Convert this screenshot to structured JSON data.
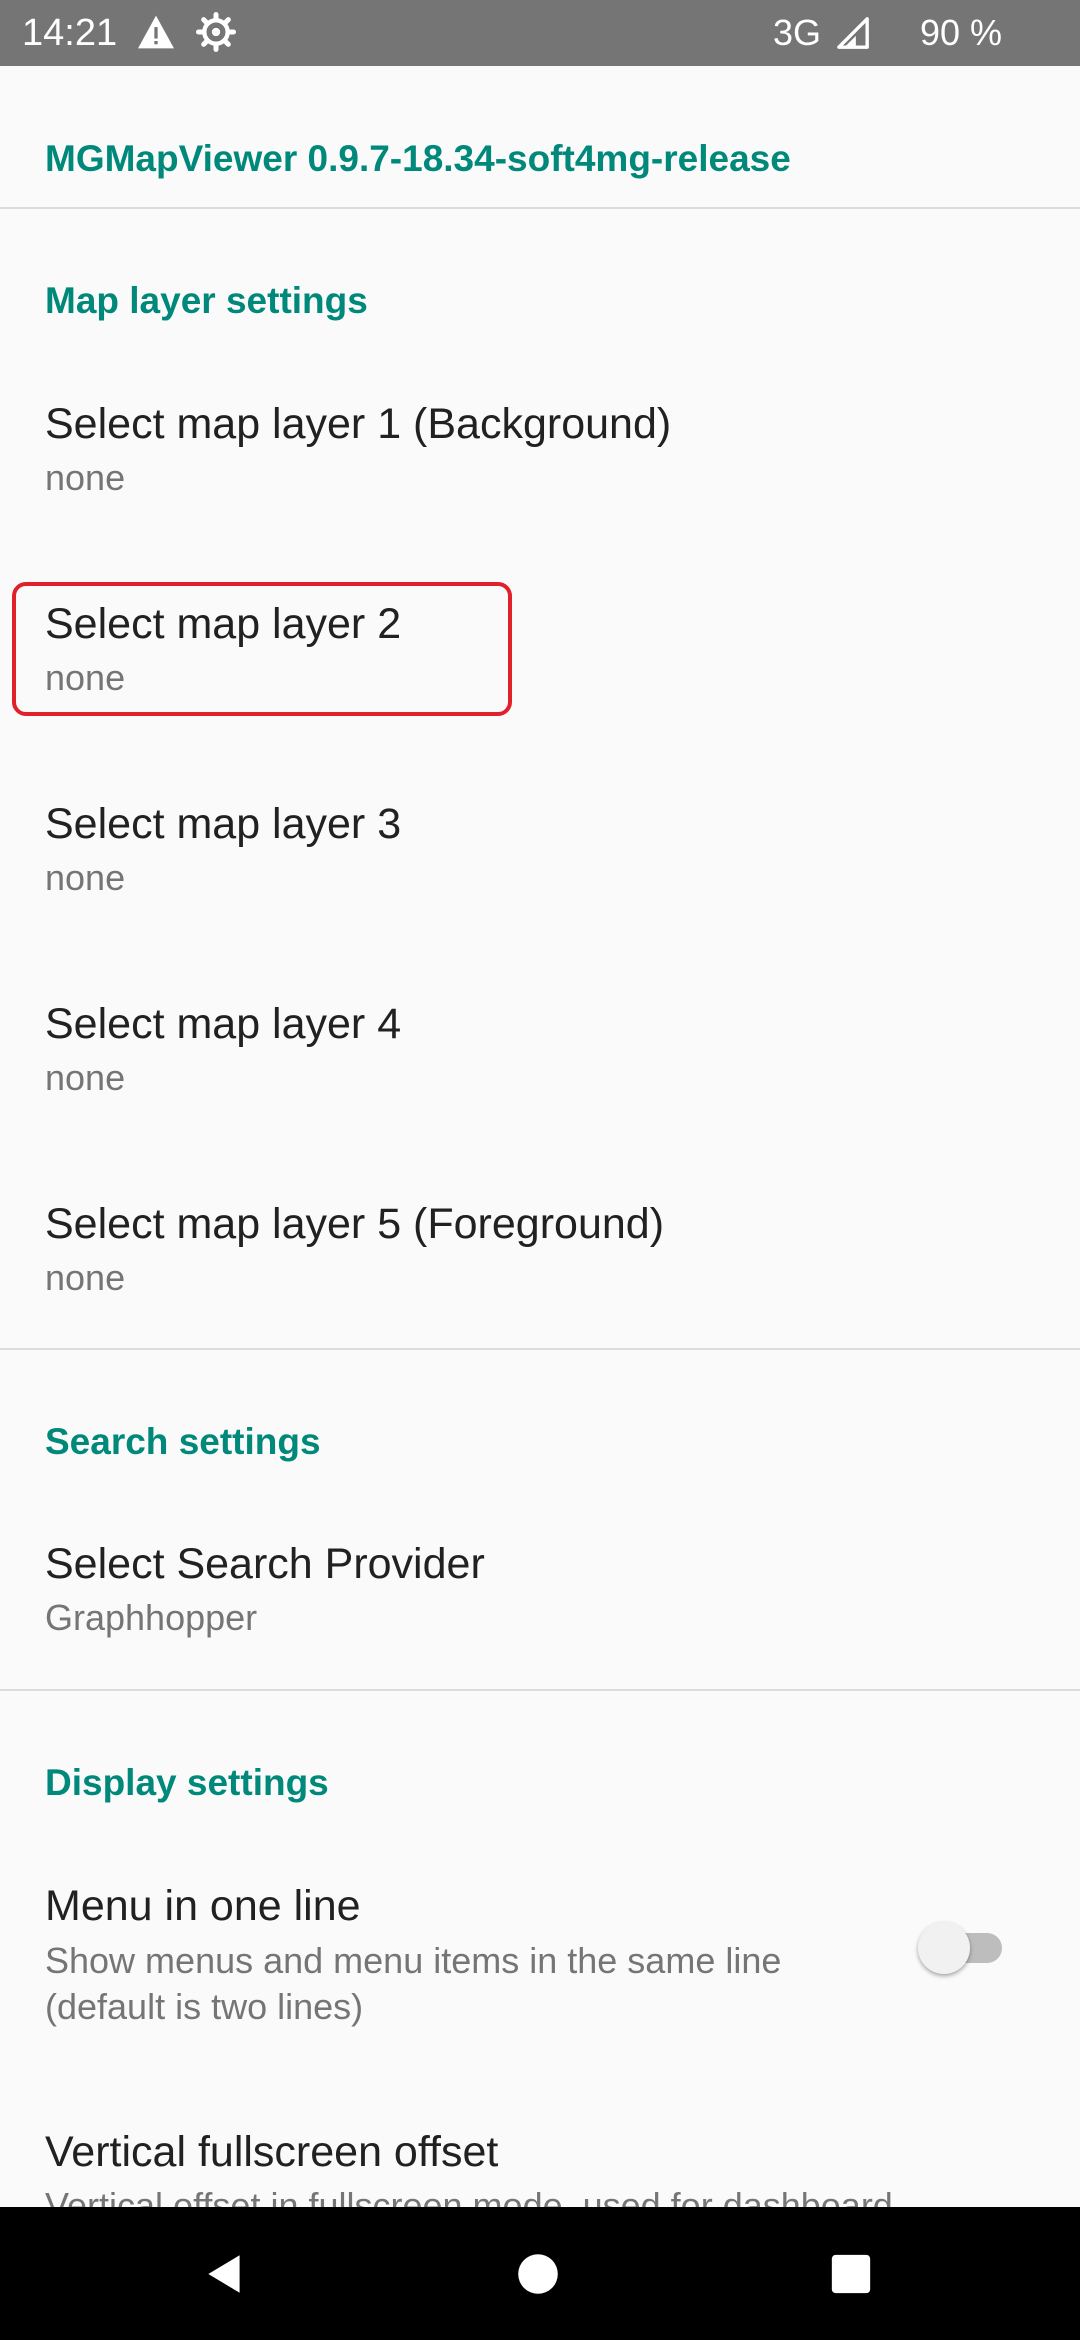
{
  "status_bar": {
    "time": "14:21",
    "network": "3G",
    "battery": "90 %",
    "icons": [
      "warning-icon",
      "gear-icon",
      "signal-icon"
    ]
  },
  "app_title": "MGMapViewer 0.9.7-18.34-soft4mg-release",
  "sections": {
    "map_layer": {
      "header": "Map layer settings",
      "items": [
        {
          "title": "Select map layer 1 (Background)",
          "summary": "none"
        },
        {
          "title": "Select map layer 2",
          "summary": "none"
        },
        {
          "title": "Select map layer 3",
          "summary": "none"
        },
        {
          "title": "Select map layer 4",
          "summary": "none"
        },
        {
          "title": "Select map layer 5 (Foreground)",
          "summary": "none"
        }
      ]
    },
    "search": {
      "header": "Search settings",
      "items": [
        {
          "title": "Select Search Provider",
          "summary": "Graphhopper"
        }
      ]
    },
    "display": {
      "header": "Display settings",
      "items": [
        {
          "title": "Menu in one line",
          "summary": "Show menus and menu items in the same line (default is two lines)",
          "toggle_on": false
        },
        {
          "title": "Vertical fullscreen offset",
          "summary": "Vertical offset in fullscreen mode, used for dashboard"
        }
      ]
    }
  },
  "colors": {
    "accent": "#00897b",
    "highlight": "#e0202a",
    "status_bar": "#757575",
    "nav_bar": "#000000"
  },
  "nav_bar": {
    "icons": [
      "back-icon",
      "home-icon",
      "recents-icon"
    ]
  }
}
